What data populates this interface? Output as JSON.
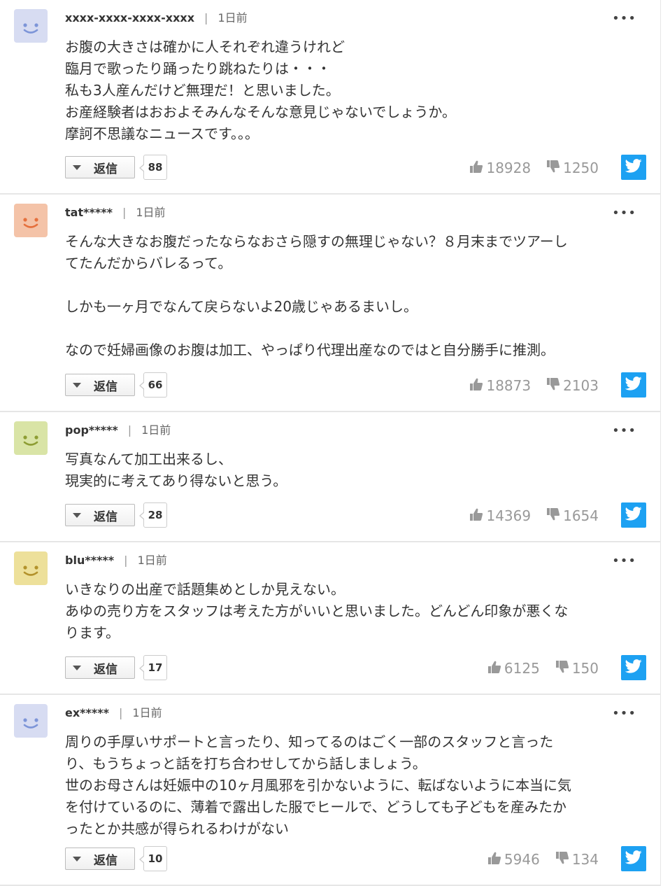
{
  "comments": [
    {
      "author": "xxxx-xxxx-xxxx-xxxx",
      "time": "1日前",
      "avatar_color": "#d7dcf2",
      "avatar_feature_color": "#7d95d8",
      "text": "お腹の大きさは確かに人それぞれ違うけれど\n臨月で歌ったり踊ったり跳ねたりは・・・\n私も3人産んだけど無理だ！と思いました。\nお産経験者はおおよそみんなそんな意見じゃないでしょうか。\n摩訶不思議なニュースです。。。",
      "reply_label": "返信",
      "reply_count": "88",
      "likes": "18928",
      "dislikes": "1250"
    },
    {
      "author": "tat*****",
      "time": "1日前",
      "avatar_color": "#f4c3a8",
      "avatar_feature_color": "#e5703d",
      "text": "そんな大きなお腹だったならなおさら隠すの無理じゃない？８月末までツアーし\nてたんだからバレるって。\n\nしかも一ヶ月でなんて戻らないよ20歳じゃあるまいし。\n\nなので妊婦画像のお腹は加工、やっぱり代理出産なのではと自分勝手に推測。",
      "reply_label": "返信",
      "reply_count": "66",
      "likes": "18873",
      "dislikes": "2103"
    },
    {
      "author": "pop*****",
      "time": "1日前",
      "avatar_color": "#d9e4a6",
      "avatar_feature_color": "#8d9d33",
      "text": "写真なんて加工出来るし、\n現実的に考えてあり得ないと思う。",
      "reply_label": "返信",
      "reply_count": "28",
      "likes": "14369",
      "dislikes": "1654"
    },
    {
      "author": "blu*****",
      "time": "1日前",
      "avatar_color": "#ede09a",
      "avatar_feature_color": "#b3922b",
      "text": "いきなりの出産で話題集めとしか見えない。\nあゆの売り方をスタッフは考えた方がいいと思いました。どんどん印象が悪くな\nります。",
      "reply_label": "返信",
      "reply_count": "17",
      "likes": "6125",
      "dislikes": "150"
    },
    {
      "author": "ex*****",
      "time": "1日前",
      "avatar_color": "#d7dcf2",
      "avatar_feature_color": "#7d95d8",
      "text": "周りの手厚いサポートと言ったり、知ってるのはごく一部のスタッフと言った\nり、もうちょっと話を打ち合わせしてから話しましょう。\n世のお母さんは妊娠中の10ヶ月風邪を引かないように、転ばないように本当に気\nを付けているのに、薄着で露出した服でヒールで、どうしても子どもを産みたか\nったとか共感が得られるわけがない",
      "reply_label": "返信",
      "reply_count": "10",
      "likes": "5946",
      "dislikes": "134"
    }
  ],
  "icons": {
    "more": "more-options-icon",
    "like": "thumbs-up-icon",
    "dislike": "thumbs-down-icon",
    "share": "twitter-icon",
    "reply_caret": "caret-down-icon"
  },
  "colors": {
    "twitter": "#1da1f2",
    "vote_gray": "#999999",
    "divider": "#e6e6e6"
  }
}
